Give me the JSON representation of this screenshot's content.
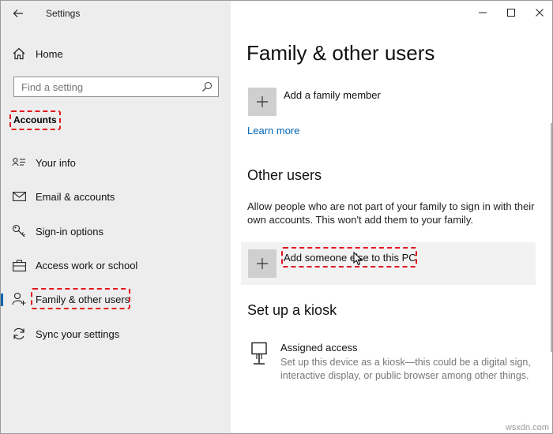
{
  "app": {
    "title": "Settings"
  },
  "sidebar": {
    "home_label": "Home",
    "search_placeholder": "Find a setting",
    "section_heading": "Accounts",
    "items": [
      {
        "label": "Your info",
        "icon": "your-info-icon"
      },
      {
        "label": "Email & accounts",
        "icon": "mail-icon"
      },
      {
        "label": "Sign-in options",
        "icon": "key-icon"
      },
      {
        "label": "Access work or school",
        "icon": "briefcase-icon"
      },
      {
        "label": "Family & other users",
        "icon": "person-add-icon",
        "active": true
      },
      {
        "label": "Sync your settings",
        "icon": "sync-icon"
      }
    ]
  },
  "main": {
    "title": "Family & other users",
    "add_family_label": "Add a family member",
    "learn_more": "Learn more",
    "other_users_heading": "Other users",
    "other_users_desc": "Allow people who are not part of your family to sign in with their own accounts. This won't add them to your family.",
    "add_someone_label": "Add someone else to this PC",
    "kiosk_heading": "Set up a kiosk",
    "assigned_access_title": "Assigned access",
    "assigned_access_desc": "Set up this device as a kiosk—this could be a digital sign, interactive display, or public browser among other things."
  },
  "colors": {
    "accent": "#0063b1",
    "highlight_dash": "#e0151a",
    "sidebar_bg": "#ededed"
  },
  "watermark": "wsxdn.com"
}
